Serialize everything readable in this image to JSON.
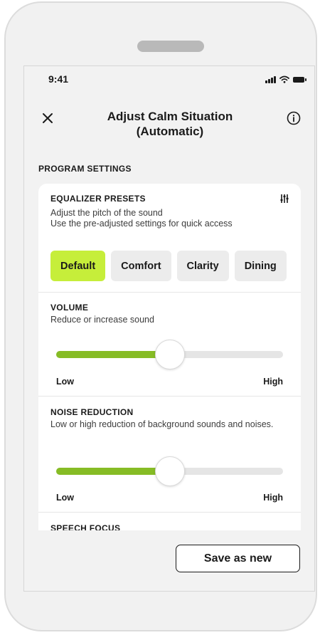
{
  "status": {
    "time": "9:41"
  },
  "header": {
    "title_line1": "Adjust Calm Situation",
    "title_line2": "(Automatic)"
  },
  "section": {
    "title": "PROGRAM SETTINGS"
  },
  "equalizer": {
    "title": "EQUALIZER PRESETS",
    "desc_line1": "Adjust the pitch of the sound",
    "desc_line2": "Use the pre-adjusted settings for quick access",
    "presets": [
      "Default",
      "Comfort",
      "Clarity",
      "Dining"
    ],
    "selected": "Default"
  },
  "volume": {
    "title": "VOLUME",
    "desc": "Reduce or increase sound",
    "low": "Low",
    "high": "High",
    "level": 0.5
  },
  "noise_reduction": {
    "title": "NOISE REDUCTION",
    "desc": "Low or high reduction of background sounds and noises.",
    "low": "Low",
    "high": "High",
    "level": 0.5
  },
  "speech_focus": {
    "title": "SPEECH FOCUS"
  },
  "actions": {
    "save_label": "Save as new"
  },
  "colors": {
    "accent_selected": "#c6ee3a",
    "slider_fill": "#86bc25"
  }
}
